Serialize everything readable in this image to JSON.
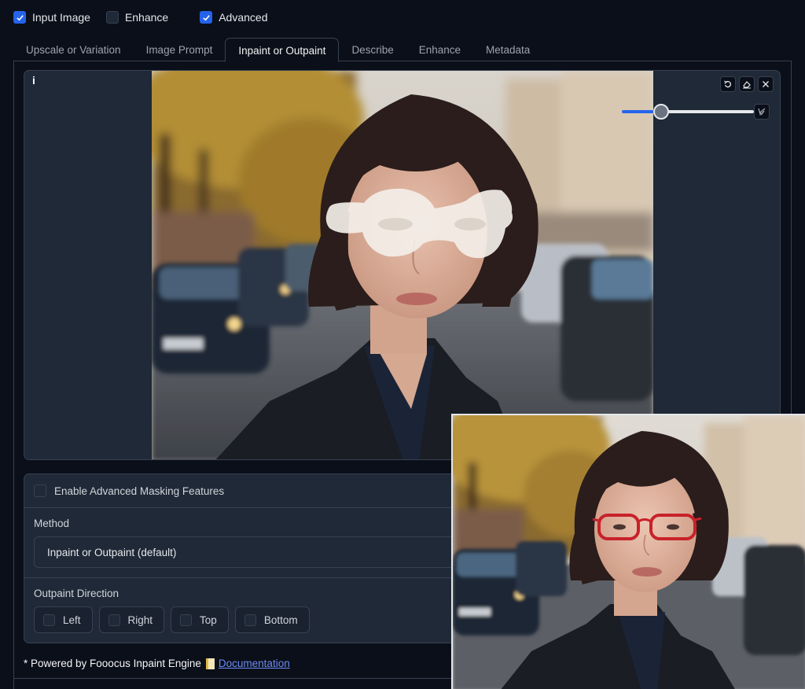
{
  "top_checkboxes": [
    {
      "label": "Input Image",
      "checked": true
    },
    {
      "label": "Enhance",
      "checked": false
    },
    {
      "label": "Advanced",
      "checked": true
    }
  ],
  "tabs": [
    {
      "label": "Upscale or Variation",
      "active": false
    },
    {
      "label": "Image Prompt",
      "active": false
    },
    {
      "label": "Inpaint or Outpaint",
      "active": true
    },
    {
      "label": "Describe",
      "active": false
    },
    {
      "label": "Enhance",
      "active": false
    },
    {
      "label": "Metadata",
      "active": false
    }
  ],
  "editor": {
    "label": "i",
    "tools": [
      "undo-icon",
      "eraser-icon",
      "close-icon"
    ],
    "brush_tool": "brush-color-icon",
    "brush_size_fraction": 0.3,
    "image_description": "Woman with short dark bob haircut on a city street, white mask painted over eyes"
  },
  "options": {
    "advanced_masking_label": "Enable Advanced Masking Features",
    "advanced_masking_checked": false,
    "method_label": "Method",
    "method_value": "Inpaint or Outpaint (default)",
    "outpaint_label": "Outpaint Direction",
    "directions": [
      {
        "label": "Left",
        "checked": false
      },
      {
        "label": "Right",
        "checked": false
      },
      {
        "label": "Top",
        "checked": false
      },
      {
        "label": "Bottom",
        "checked": false
      }
    ]
  },
  "footer": {
    "text": "* Powered by Fooocus Inpaint Engine",
    "icon": "document-icon",
    "link_text": "Documentation"
  },
  "result_image": {
    "description": "Result: woman wearing red eyeglasses on city street"
  },
  "colors": {
    "accent": "#2563eb",
    "background": "#0b0f19",
    "panel": "#1f2937",
    "border": "#374151",
    "link": "#6b8cf5"
  }
}
